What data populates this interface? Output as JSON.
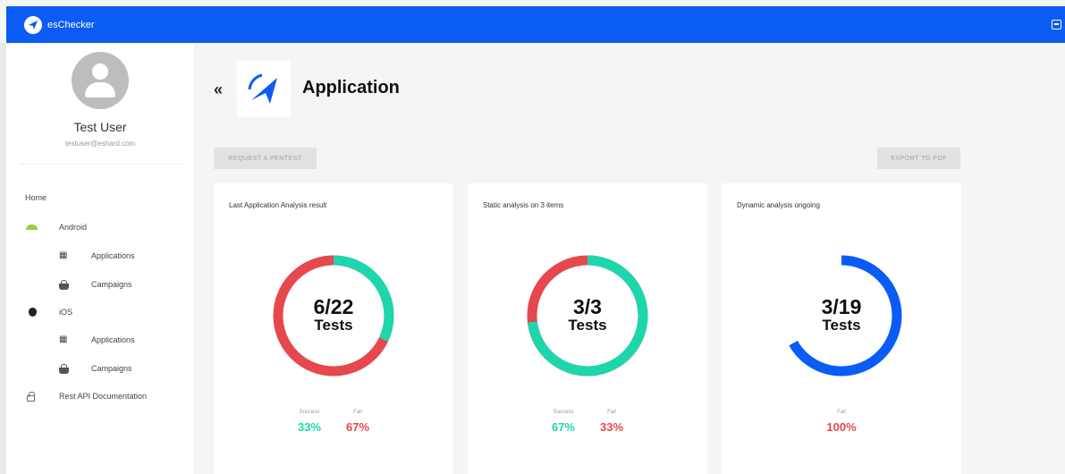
{
  "header": {
    "app_name": "esChecker",
    "bg_color": "#0b5cf5"
  },
  "sidebar": {
    "user_name": "Test User",
    "user_email": "testuser@eshard.com",
    "items": [
      {
        "label": "Home",
        "icon": ""
      },
      {
        "label": "Android",
        "icon": "android-icon"
      },
      {
        "label": "Applications",
        "icon": "grid-icon"
      },
      {
        "label": "Campaigns",
        "icon": "basket-icon"
      },
      {
        "label": "iOS",
        "icon": "apple-icon"
      },
      {
        "label": "Applications",
        "icon": "grid-icon"
      },
      {
        "label": "Campaigns",
        "icon": "basket-icon"
      },
      {
        "label": "Rest API Documentation",
        "icon": "lock-icon"
      }
    ]
  },
  "main": {
    "back_label": "«",
    "title": "Application",
    "request_button": "Request a pentest",
    "export_button": "Export to PDF"
  },
  "cards": [
    {
      "title": "Last Application Analysis result",
      "count_text": "6/22",
      "unit_text": "Tests",
      "legend": [
        {
          "label": "Success",
          "value": "33%",
          "color": "#1dd6ac"
        },
        {
          "label": "Fail",
          "value": "67%",
          "color": "#e5484d"
        }
      ]
    },
    {
      "title": "Static analysis on 3 items",
      "count_text": "3/3",
      "unit_text": "Tests",
      "legend": [
        {
          "label": "Success",
          "value": "67%",
          "color": "#1dd6ac"
        },
        {
          "label": "Fail",
          "value": "33%",
          "color": "#e5484d"
        }
      ]
    },
    {
      "title": "Dynamic analysis ongoing",
      "count_text": "3/19",
      "unit_text": "Tests",
      "legend": [
        {
          "label": "Fail",
          "value": "100%",
          "color": "#e5484d"
        }
      ]
    }
  ],
  "colors": {
    "success": "#1dd6ac",
    "fail": "#e5484d",
    "progress": "#0b5cf5"
  }
}
